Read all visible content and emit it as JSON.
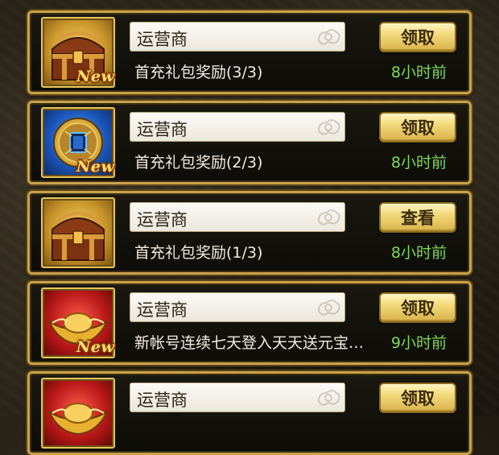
{
  "colors": {
    "frame_gold": "#c9a24a",
    "time_green": "#7ed957",
    "badge_yellow": "#ffe070"
  },
  "messages": [
    {
      "icon": "treasure-chest-icon",
      "icon_bg": "gold",
      "new_badge": "New",
      "sender": "运营商",
      "subject": "首充礼包奖励(3/3)",
      "button": "领取",
      "time": "8小时前"
    },
    {
      "icon": "jade-coin-icon",
      "icon_bg": "blue",
      "new_badge": "New",
      "sender": "运营商",
      "subject": "首充礼包奖励(2/3)",
      "button": "领取",
      "time": "8小时前"
    },
    {
      "icon": "treasure-chest-icon",
      "icon_bg": "gold",
      "new_badge": "",
      "sender": "运营商",
      "subject": "首充礼包奖励(1/3)",
      "button": "查看",
      "time": "8小时前"
    },
    {
      "icon": "gold-ingot-icon",
      "icon_bg": "red",
      "new_badge": "New",
      "sender": "运营商",
      "subject": "新帐号连续七天登入天天送元宝…",
      "button": "领取",
      "time": "9小时前"
    },
    {
      "icon": "gold-ingot-icon",
      "icon_bg": "red",
      "new_badge": "",
      "sender": "运营商",
      "subject": "",
      "button": "领取",
      "time": ""
    }
  ]
}
